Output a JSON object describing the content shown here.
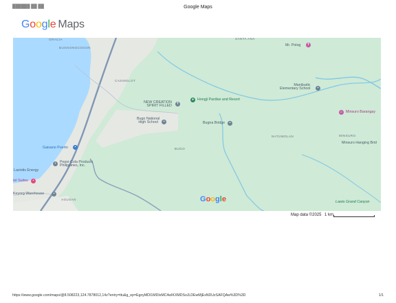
{
  "header": {
    "left_blurred": "██████ ██ ██",
    "title": "Google Maps"
  },
  "logo": {
    "google": "Google",
    "maps": "Maps"
  },
  "colors": {
    "water": "#aadaff",
    "park": "#cfead6",
    "urban": "#e8eae7",
    "road": "#7f97b3",
    "river": "#7fc7e6"
  },
  "map": {
    "areas": {
      "gracia": "GRACIA",
      "santa_ana": "SANTA ANA",
      "bugnongcogon": "BUGNONGCOGON",
      "casinglot": "CASINGLOT",
      "bugo": "BUGO",
      "natumolan": "NATUMOLAN",
      "minsuro": "MINSURO",
      "agusan": "AGUSAN"
    },
    "pois": {
      "mr_polog": "Mr. Polog",
      "manibudic_school": "Manibudic\nElementary School",
      "minsuro_barangay": "Minsuro Barangay",
      "new_creation": "NEW CREATION\nSPIRIT FILLED",
      "hongji": "Hongji Pardise and Resort",
      "bugo_nhs": "Bugo National\nHigh School",
      "bugna_bridge": "Bugna Bridge",
      "minsuro_hanging": "Minsuro Hanging Brid",
      "gaisano": "Gaisano Puerto",
      "pepsi": "Pepsi-Cola Products\nPhilippines, Inc.",
      "ls_energy": "Laviotis Energy",
      "hotel": "tel Suites",
      "warehouse": "Keyorg Warehouse",
      "lawis": "Lawis Grand Canyon"
    },
    "google_mark": [
      "G",
      "o",
      "o",
      "g",
      "l",
      "e"
    ],
    "google_mark_colors": [
      "#4285f4",
      "#ea4335",
      "#fbbc05",
      "#4285f4",
      "#34a853",
      "#ea4335"
    ]
  },
  "footer": {
    "attribution": "Map data ©2025",
    "scale": "1 km",
    "url": "https://www.google.com/maps/@8.508223,124.7878012,14z?entry=ttu&g_ep=EgoyMDI1MDIxMC4wIKXMDSoJLDEwMjExNDUzSAFQAw%3D%3D",
    "page": "1/1"
  },
  "icons": [
    "school-icon",
    "park-icon",
    "shopping-icon",
    "landmark-icon",
    "hotel-icon",
    "church-icon"
  ]
}
